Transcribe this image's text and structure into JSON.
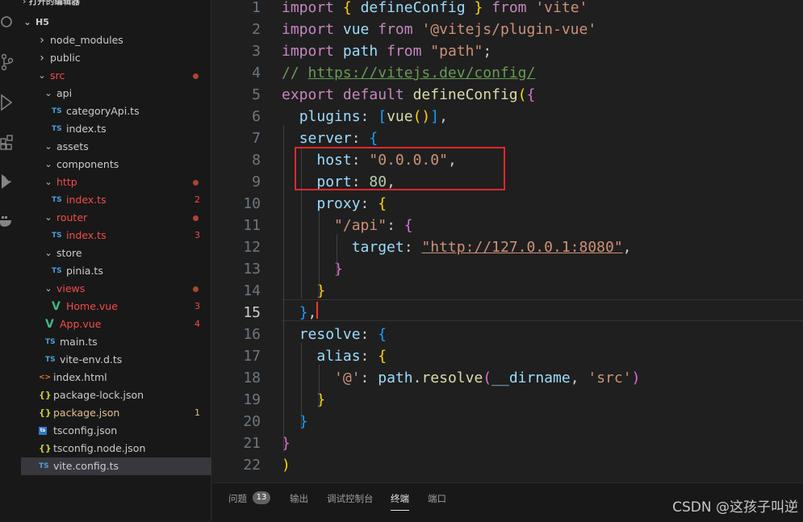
{
  "sidebar": {
    "header": "打开的编辑器",
    "root": "H5",
    "tree": [
      {
        "label": "node_modules",
        "kind": "folder",
        "open": false,
        "indent": 1,
        "color": "#cccccc"
      },
      {
        "label": "public",
        "kind": "folder",
        "open": false,
        "indent": 1,
        "color": "#cccccc"
      },
      {
        "label": "src",
        "kind": "folder",
        "open": true,
        "indent": 1,
        "color": "#f14c4c",
        "dot": true
      },
      {
        "label": "api",
        "kind": "folder",
        "open": true,
        "indent": 2,
        "color": "#cccccc"
      },
      {
        "label": "categoryApi.ts",
        "kind": "ts",
        "indent": 3,
        "color": "#cccccc"
      },
      {
        "label": "index.ts",
        "kind": "ts",
        "indent": 3,
        "color": "#cccccc"
      },
      {
        "label": "assets",
        "kind": "folder",
        "open": true,
        "indent": 2,
        "color": "#cccccc"
      },
      {
        "label": "components",
        "kind": "folder",
        "open": true,
        "indent": 2,
        "color": "#cccccc"
      },
      {
        "label": "http",
        "kind": "folder",
        "open": true,
        "indent": 2,
        "color": "#f14c4c",
        "dot": true
      },
      {
        "label": "index.ts",
        "kind": "ts",
        "indent": 3,
        "color": "#f14c4c",
        "badge": "2"
      },
      {
        "label": "router",
        "kind": "folder",
        "open": true,
        "indent": 2,
        "color": "#f14c4c",
        "dot": true
      },
      {
        "label": "index.ts",
        "kind": "ts",
        "indent": 3,
        "color": "#f14c4c",
        "badge": "3"
      },
      {
        "label": "store",
        "kind": "folder",
        "open": true,
        "indent": 2,
        "color": "#cccccc"
      },
      {
        "label": "pinia.ts",
        "kind": "ts",
        "indent": 3,
        "color": "#cccccc"
      },
      {
        "label": "views",
        "kind": "folder",
        "open": true,
        "indent": 2,
        "color": "#f14c4c",
        "dot": true
      },
      {
        "label": "Home.vue",
        "kind": "vue",
        "indent": 3,
        "color": "#f14c4c",
        "badge": "3"
      },
      {
        "label": "App.vue",
        "kind": "vue",
        "indent": 2,
        "color": "#f14c4c",
        "badge": "4"
      },
      {
        "label": "main.ts",
        "kind": "ts",
        "indent": 2,
        "color": "#cccccc"
      },
      {
        "label": "vite-env.d.ts",
        "kind": "ts",
        "indent": 2,
        "color": "#cccccc"
      },
      {
        "label": "index.html",
        "kind": "html",
        "indent": 1,
        "color": "#cccccc"
      },
      {
        "label": "package-lock.json",
        "kind": "json",
        "indent": 1,
        "color": "#cccccc"
      },
      {
        "label": "package.json",
        "kind": "json",
        "indent": 1,
        "color": "#e2c08d",
        "badge": "1",
        "badgeColor": "#e2c08d"
      },
      {
        "label": "tsconfig.json",
        "kind": "tsconfig",
        "indent": 1,
        "color": "#cccccc"
      },
      {
        "label": "tsconfig.node.json",
        "kind": "json",
        "indent": 1,
        "color": "#cccccc"
      },
      {
        "label": "vite.config.ts",
        "kind": "ts",
        "indent": 1,
        "color": "#cccccc",
        "active": true
      }
    ]
  },
  "editor": {
    "current_line": 15,
    "lines": [
      [
        [
          "kw",
          "import"
        ],
        [
          "pl",
          " "
        ],
        [
          "b1",
          "{"
        ],
        [
          "pl",
          " "
        ],
        [
          "id",
          "defineConfig"
        ],
        [
          "pl",
          " "
        ],
        [
          "b1",
          "}"
        ],
        [
          "pl",
          " "
        ],
        [
          "kw",
          "from"
        ],
        [
          "pl",
          " "
        ],
        [
          "str",
          "'vite'"
        ]
      ],
      [
        [
          "kw",
          "import"
        ],
        [
          "pl",
          " "
        ],
        [
          "id",
          "vue"
        ],
        [
          "pl",
          " "
        ],
        [
          "kw",
          "from"
        ],
        [
          "pl",
          " "
        ],
        [
          "str",
          "'@vitejs/plugin-vue'"
        ]
      ],
      [
        [
          "kw",
          "import"
        ],
        [
          "pl",
          " "
        ],
        [
          "id",
          "path"
        ],
        [
          "pl",
          " "
        ],
        [
          "kw",
          "from"
        ],
        [
          "pl",
          " "
        ],
        [
          "str",
          "\"path\""
        ],
        [
          "pl",
          ";"
        ]
      ],
      [
        [
          "cm",
          "// "
        ],
        [
          "cmlink",
          "https://vitejs.dev/config/"
        ]
      ],
      [
        [
          "kw",
          "export"
        ],
        [
          "pl",
          " "
        ],
        [
          "kw",
          "default"
        ],
        [
          "pl",
          " "
        ],
        [
          "fn",
          "defineConfig"
        ],
        [
          "b1",
          "("
        ],
        [
          "b2",
          "{"
        ]
      ],
      [
        [
          "pl",
          "  "
        ],
        [
          "id",
          "plugins"
        ],
        [
          "pl",
          ": "
        ],
        [
          "b3",
          "["
        ],
        [
          "fn",
          "vue"
        ],
        [
          "b1",
          "()"
        ],
        [
          "b3",
          "]"
        ],
        [
          "pl",
          ","
        ]
      ],
      [
        [
          "pl",
          "  "
        ],
        [
          "id",
          "server"
        ],
        [
          "pl",
          ": "
        ],
        [
          "b3",
          "{"
        ]
      ],
      [
        [
          "pl",
          "    "
        ],
        [
          "id",
          "host"
        ],
        [
          "pl",
          ": "
        ],
        [
          "str",
          "\"0.0.0.0\""
        ],
        [
          "pl",
          ","
        ]
      ],
      [
        [
          "pl",
          "    "
        ],
        [
          "id",
          "port"
        ],
        [
          "pl",
          ": "
        ],
        [
          "num",
          "80"
        ],
        [
          "pl",
          ","
        ]
      ],
      [
        [
          "pl",
          "    "
        ],
        [
          "id",
          "proxy"
        ],
        [
          "pl",
          ": "
        ],
        [
          "b1",
          "{"
        ]
      ],
      [
        [
          "pl",
          "      "
        ],
        [
          "str",
          "\"/api\""
        ],
        [
          "pl",
          ": "
        ],
        [
          "b2",
          "{"
        ]
      ],
      [
        [
          "pl",
          "        "
        ],
        [
          "id",
          "target"
        ],
        [
          "pl",
          ": "
        ],
        [
          "strlink",
          "\"http://127.0.0.1:8080\""
        ],
        [
          "pl",
          ","
        ]
      ],
      [
        [
          "pl",
          "      "
        ],
        [
          "b2",
          "}"
        ]
      ],
      [
        [
          "pl",
          "    "
        ],
        [
          "b1",
          "}"
        ]
      ],
      [
        [
          "pl",
          "  "
        ],
        [
          "b3",
          "}"
        ],
        [
          "pl",
          ","
        ]
      ],
      [
        [
          "pl",
          "  "
        ],
        [
          "id",
          "resolve"
        ],
        [
          "pl",
          ": "
        ],
        [
          "b3",
          "{"
        ]
      ],
      [
        [
          "pl",
          "    "
        ],
        [
          "id",
          "alias"
        ],
        [
          "pl",
          ": "
        ],
        [
          "b1",
          "{"
        ]
      ],
      [
        [
          "pl",
          "      "
        ],
        [
          "str",
          "'@'"
        ],
        [
          "pl",
          ": "
        ],
        [
          "id",
          "path"
        ],
        [
          "pl",
          "."
        ],
        [
          "fn",
          "resolve"
        ],
        [
          "b2",
          "("
        ],
        [
          "id",
          "__dirname"
        ],
        [
          "pl",
          ", "
        ],
        [
          "str",
          "'src'"
        ],
        [
          "b2",
          ")"
        ]
      ],
      [
        [
          "pl",
          "    "
        ],
        [
          "b1",
          "}"
        ]
      ],
      [
        [
          "pl",
          "  "
        ],
        [
          "b3",
          "}"
        ]
      ],
      [
        [
          "b2",
          "}"
        ]
      ],
      [
        [
          "b1",
          ")"
        ]
      ]
    ],
    "line_numbers": [
      "1",
      "2",
      "3",
      "4",
      "5",
      "6",
      "7",
      "8",
      "9",
      "10",
      "11",
      "12",
      "13",
      "14",
      "15",
      "16",
      "17",
      "18",
      "19",
      "20",
      "21",
      "22"
    ]
  },
  "panel": {
    "tabs": [
      {
        "label": "问题",
        "active": false
      },
      {
        "label": "输出",
        "active": false
      },
      {
        "label": "调试控制台",
        "active": false
      },
      {
        "label": "终端",
        "active": true
      },
      {
        "label": "端口",
        "active": false
      }
    ],
    "problems_count": "13"
  },
  "watermark": "CSDN @这孩子叫逆"
}
